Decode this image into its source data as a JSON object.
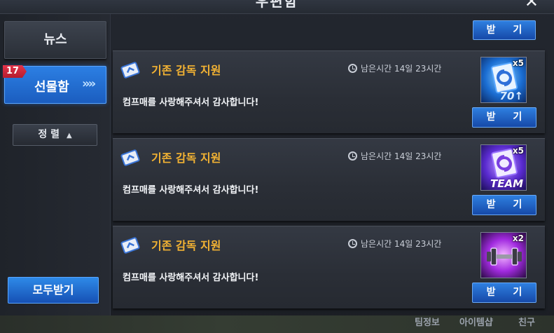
{
  "window": {
    "title": "우편함"
  },
  "sidebar": {
    "tabs": [
      {
        "label": "뉴스"
      },
      {
        "label": "선물함",
        "badge": "17",
        "arrows": "»»"
      }
    ],
    "sort_label": "정 렬",
    "sort_caret": "▲",
    "receive_all_label": "모두받기"
  },
  "top_receive_label": "받 기",
  "gifts": [
    {
      "title": "기존 감독 지원",
      "time_left": "남은시간 14일 23시간",
      "message": "컴프매를 사랑해주셔서 감사합니다!",
      "item_icon": "card-upgrade-icon",
      "count": "x5",
      "sub_label": "70↑",
      "receive_label": "받 기"
    },
    {
      "title": "기존 감독 지원",
      "time_left": "남은시간 14일 23시간",
      "message": "컴프매를 사랑해주셔서 감사합니다!",
      "item_icon": "team-card-icon",
      "count": "x5",
      "sub_label": "TEAM",
      "receive_label": "받 기"
    },
    {
      "title": "기존 감독 지원",
      "time_left": "남은시간 14일 23시간",
      "message": "컴프매를 사랑해주셔서 감사합니다!",
      "item_icon": "dumbbell-icon",
      "count": "x2",
      "sub_label": "",
      "receive_label": "받 기"
    }
  ],
  "bottom_nav": [
    "팀정보",
    "아이템샵",
    "친구"
  ]
}
